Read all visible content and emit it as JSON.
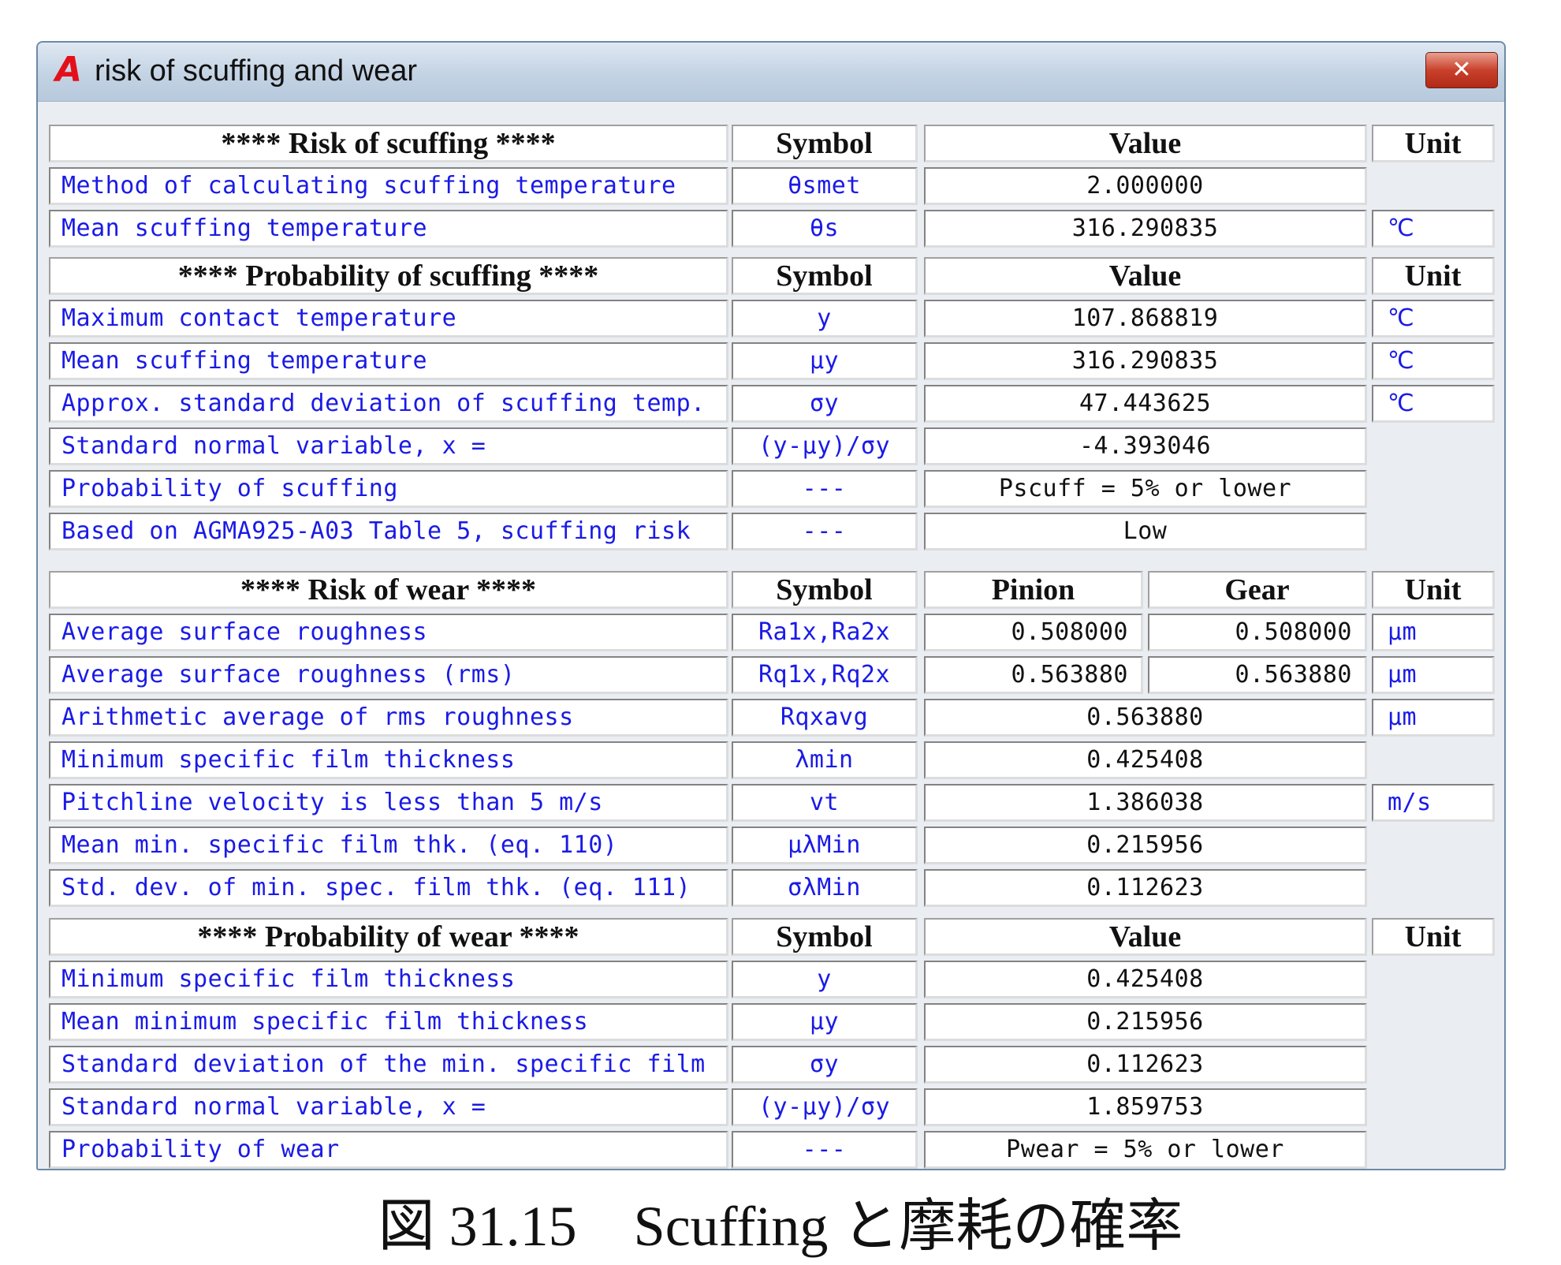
{
  "window": {
    "title": "risk of scuffing and wear",
    "app_icon_letter": "A",
    "close_glyph": "✕"
  },
  "s1": {
    "header": {
      "title": "**** Risk of scuffing ****",
      "symbol": "Symbol",
      "value": "Value",
      "unit": "Unit"
    },
    "rows": [
      {
        "label": "Method of calculating scuffing temperature",
        "symbol": "θsmet",
        "value": "2.000000",
        "unit": ""
      },
      {
        "label": "Mean scuffing temperature",
        "symbol": "θs",
        "value": "316.290835",
        "unit": "℃"
      }
    ]
  },
  "s2": {
    "header": {
      "title": "**** Probability of scuffing ****",
      "symbol": "Symbol",
      "value": "Value",
      "unit": "Unit"
    },
    "rows": [
      {
        "label": "Maximum contact temperature",
        "symbol": "y",
        "value": "107.868819",
        "unit": "℃"
      },
      {
        "label": "Mean scuffing temperature",
        "symbol": "μy",
        "value": "316.290835",
        "unit": "℃"
      },
      {
        "label": "Approx. standard deviation of scuffing temp.",
        "symbol": "σy",
        "value": "47.443625",
        "unit": "℃"
      },
      {
        "label": "Standard normal variable, x =",
        "symbol": "(y-μy)/σy",
        "value": "-4.393046",
        "unit": ""
      },
      {
        "label": "Probability of scuffing",
        "symbol": "---",
        "value": "Pscuff = 5% or lower",
        "unit": ""
      },
      {
        "label": "Based on AGMA925-A03 Table 5, scuffing risk",
        "symbol": "---",
        "value": "Low",
        "unit": ""
      }
    ]
  },
  "s3": {
    "header": {
      "title": "**** Risk of wear ****",
      "symbol": "Symbol",
      "pinion": "Pinion",
      "gear": "Gear",
      "unit": "Unit"
    },
    "rows": [
      {
        "label": "Average surface roughness",
        "symbol": "Ra1x,Ra2x",
        "pinion": "0.508000",
        "gear": "0.508000",
        "unit": "μm"
      },
      {
        "label": "Average surface roughness (rms)",
        "symbol": "Rq1x,Rq2x",
        "pinion": "0.563880",
        "gear": "0.563880",
        "unit": "μm"
      },
      {
        "label": "Arithmetic average of rms roughness",
        "symbol": "Rqxavg",
        "value": "0.563880",
        "unit": "μm"
      },
      {
        "label": "Minimum specific film thickness",
        "symbol": "λmin",
        "value": "0.425408",
        "unit": ""
      },
      {
        "label": "Pitchline velocity is less than 5 m/s",
        "symbol": "vt",
        "value": "1.386038",
        "unit": "m/s"
      },
      {
        "label": "Mean min. specific film thk. (eq. 110)",
        "symbol": "μλMin",
        "value": "0.215956",
        "unit": ""
      },
      {
        "label": "Std. dev. of min. spec. film thk. (eq. 111)",
        "symbol": "σλMin",
        "value": "0.112623",
        "unit": ""
      }
    ]
  },
  "s4": {
    "header": {
      "title": "**** Probability of wear ****",
      "symbol": "Symbol",
      "value": "Value",
      "unit": "Unit"
    },
    "rows": [
      {
        "label": "Minimum specific film thickness",
        "symbol": "y",
        "value": "0.425408",
        "unit": ""
      },
      {
        "label": "Mean minimum specific film thickness",
        "symbol": "μy",
        "value": "0.215956",
        "unit": ""
      },
      {
        "label": "Standard deviation of the min. specific film",
        "symbol": "σy",
        "value": "0.112623",
        "unit": ""
      },
      {
        "label": "Standard normal variable, x =",
        "symbol": "(y-μy)/σy",
        "value": "1.859753",
        "unit": ""
      },
      {
        "label": "Probability of wear",
        "symbol": "---",
        "value": "Pwear = 5% or lower",
        "unit": ""
      }
    ]
  },
  "caption": "図 31.15　Scuffing と摩耗の確率"
}
